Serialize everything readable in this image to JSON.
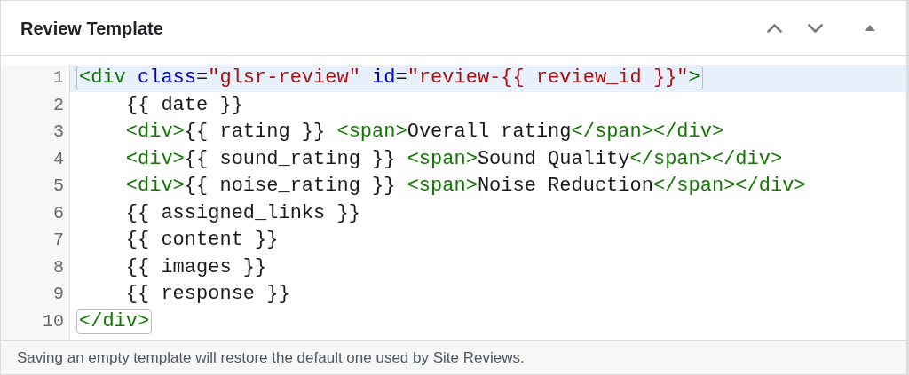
{
  "panel": {
    "title": "Review Template",
    "controls": [
      {
        "kind": "up"
      },
      {
        "kind": "down"
      },
      {
        "kind": "toggle"
      }
    ]
  },
  "editor": {
    "lines": [
      {
        "number": "1",
        "selected": true,
        "matched": true,
        "tokens": [
          {
            "kind": "tag",
            "text": "<div"
          },
          {
            "kind": "attr",
            "text": " class"
          },
          {
            "kind": "text",
            "text": "="
          },
          {
            "kind": "string",
            "text": "\"glsr-review\""
          },
          {
            "kind": "attr",
            "text": " id"
          },
          {
            "kind": "text",
            "text": "="
          },
          {
            "kind": "string",
            "text": "\"review-{{ review_id }}\""
          },
          {
            "kind": "tag",
            "text": ">"
          }
        ]
      },
      {
        "number": "2",
        "selected": false,
        "matched": false,
        "tokens": [
          {
            "kind": "text",
            "text": "    {{ date }}"
          }
        ]
      },
      {
        "number": "3",
        "selected": false,
        "matched": false,
        "tokens": [
          {
            "kind": "tag",
            "text": "    <div>"
          },
          {
            "kind": "text",
            "text": "{{ rating }} "
          },
          {
            "kind": "tag",
            "text": "<span>"
          },
          {
            "kind": "text",
            "text": "Overall rating"
          },
          {
            "kind": "tag",
            "text": "</span></div>"
          }
        ]
      },
      {
        "number": "4",
        "selected": false,
        "matched": false,
        "tokens": [
          {
            "kind": "tag",
            "text": "    <div>"
          },
          {
            "kind": "text",
            "text": "{{ sound_rating }} "
          },
          {
            "kind": "tag",
            "text": "<span>"
          },
          {
            "kind": "text",
            "text": "Sound Quality"
          },
          {
            "kind": "tag",
            "text": "</span></div>"
          }
        ]
      },
      {
        "number": "5",
        "selected": false,
        "matched": false,
        "tokens": [
          {
            "kind": "tag",
            "text": "    <div>"
          },
          {
            "kind": "text",
            "text": "{{ noise_rating }} "
          },
          {
            "kind": "tag",
            "text": "<span>"
          },
          {
            "kind": "text",
            "text": "Noise Reduction"
          },
          {
            "kind": "tag",
            "text": "</span></div>"
          }
        ]
      },
      {
        "number": "6",
        "selected": false,
        "matched": false,
        "tokens": [
          {
            "kind": "text",
            "text": "    {{ assigned_links }}"
          }
        ]
      },
      {
        "number": "7",
        "selected": false,
        "matched": false,
        "tokens": [
          {
            "kind": "text",
            "text": "    {{ content }}"
          }
        ]
      },
      {
        "number": "8",
        "selected": false,
        "matched": false,
        "tokens": [
          {
            "kind": "text",
            "text": "    {{ images }}"
          }
        ]
      },
      {
        "number": "9",
        "selected": false,
        "matched": false,
        "tokens": [
          {
            "kind": "text",
            "text": "    {{ response }}"
          }
        ]
      },
      {
        "number": "10",
        "selected": false,
        "matched": true,
        "tokens": [
          {
            "kind": "tag",
            "text": "</div>"
          }
        ]
      }
    ]
  },
  "help_text": "Saving an empty template will restore the default one used by Site Reviews."
}
